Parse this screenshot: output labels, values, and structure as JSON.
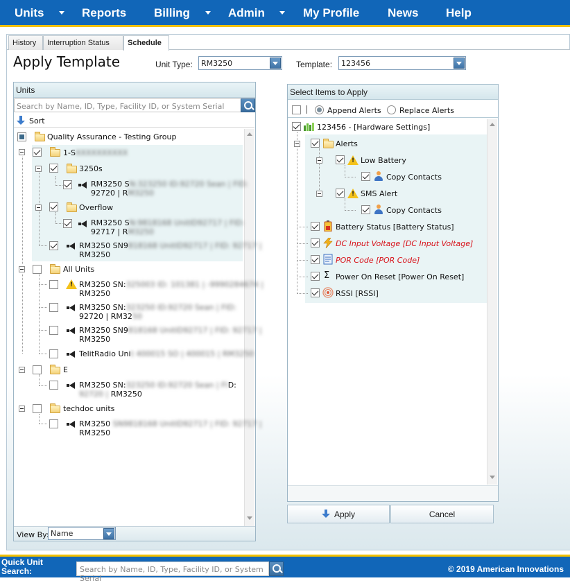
{
  "nav": {
    "items": [
      "Units",
      "Reports",
      "Billing",
      "Admin",
      "My Profile",
      "News",
      "Help"
    ]
  },
  "tabs": [
    "History",
    "Interruption Status",
    "Schedule"
  ],
  "page_title": "Apply Template",
  "unit_type": {
    "label": "Unit Type:",
    "value": "RM3250"
  },
  "template": {
    "label": "Template:",
    "value": "123456"
  },
  "units_panel": {
    "title": "Units",
    "search_placeholder": "Search by Name, ID, Type, Facility ID, or System Serial",
    "sort_label": "Sort",
    "view_by_label": "View By:",
    "view_by_value": "Name",
    "tree": {
      "root_label": "Quality Assurance - Testing Group",
      "group1_prefix": "1-S",
      "group1_blur": "XXXXXXXXXX",
      "sub_3250s": "3250s",
      "unit_a": {
        "p1": "RM3250 S",
        "b1": "N:323250 ID:92720 Sean | FID:",
        "p2": "92720 | R",
        "b2": "M3250"
      },
      "sub_overflow": "Overflow",
      "unit_b": {
        "p1": "RM3250 S",
        "b1": "N:9818168 UnitID92717 | FID:",
        "p2": "92717 | R",
        "b2": "M3250"
      },
      "unit_c": {
        "p1": "RM3250 SN9",
        "b1": "818168 UnitID92717 | FID: 92717 |",
        "p2": "RM3250"
      },
      "all_units": "All Units",
      "au1": {
        "p1": "RM3250 SN:",
        "b1": "325003 ID: 101381 | -9990284674 |",
        "p2": "RM3250"
      },
      "au2": {
        "p1": "RM3250 SN:",
        "b1": "323250 ID:92720 Sean | FID:",
        "p2": "92720 | RM32",
        "b2": "50"
      },
      "au3": {
        "p1": "RM3250 SN9",
        "b1": "818168 UnitID92717 | FID: 92717 |",
        "p2": "RM3250"
      },
      "au4": {
        "p1": "TelitRadio Uni",
        "b1": "t 400015 SO | 400015 | RM3250"
      },
      "group_e": "E",
      "ge1": {
        "p1": "RM3250 SN:",
        "b1": "323250 ID:92720 Sean | FI",
        "p1b": "D:",
        "b2": "92720 |",
        "p2": " RM3250"
      },
      "techdoc": "techdoc units",
      "td1": {
        "p1": "RM3250 ",
        "b1": "SN9818168 UnitID92717 | FID: 92717 |",
        "p2": "RM3250"
      }
    }
  },
  "items_panel": {
    "title": "Select Items to Apply",
    "append_label": "Append Alerts",
    "replace_label": "Replace Alerts",
    "rows": {
      "template_root": "123456 - [Hardware Settings]",
      "alerts": "Alerts",
      "low_battery": "Low Battery",
      "copy_contacts_1": "Copy Contacts",
      "sms_alert": "SMS Alert",
      "copy_contacts_2": "Copy Contacts",
      "battery_status": "Battery Status [Battery Status]",
      "dc_input": "DC Input Voltage [DC Input Voltage]",
      "por_code": "POR Code [POR Code]",
      "power_on_reset": "Power On Reset [Power On Reset]",
      "rssi": "RSSI [RSSI]"
    }
  },
  "buttons": {
    "apply": "Apply",
    "cancel": "Cancel"
  },
  "footer": {
    "quick_search_label": "Quick Unit Search:",
    "quick_search_placeholder": "Search by Name, ID, Type, Facility ID, or System Serial",
    "copyright": "© 2019 American Innovations"
  },
  "colors": {
    "nav_bg": "#1166b8",
    "accent": "#f2c000",
    "alert_red": "#d8121a"
  }
}
